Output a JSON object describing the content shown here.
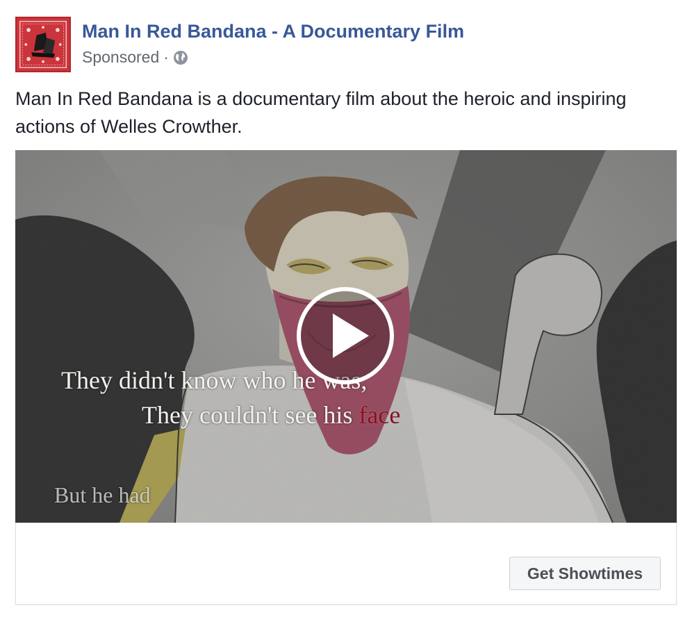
{
  "header": {
    "page_name": "Man In Red Bandana - A Documentary Film",
    "sponsored_label": "Sponsored",
    "separator": "·",
    "audience_icon": "globe-icon"
  },
  "post": {
    "text": "Man In Red Bandana is a documentary film about the heroic and inspiring actions of Welles Crowther."
  },
  "video": {
    "play_icon": "play-icon",
    "captions": {
      "line1": "They didn't know who he was,",
      "line2_prefix": "They couldn't see his ",
      "line2_highlight": "face",
      "line3": "But he had"
    }
  },
  "cta": {
    "button_label": "Get Showtimes"
  },
  "colors": {
    "link_blue": "#385898",
    "bandana_red": "#c8323a",
    "caption_highlight": "#8a1020"
  }
}
